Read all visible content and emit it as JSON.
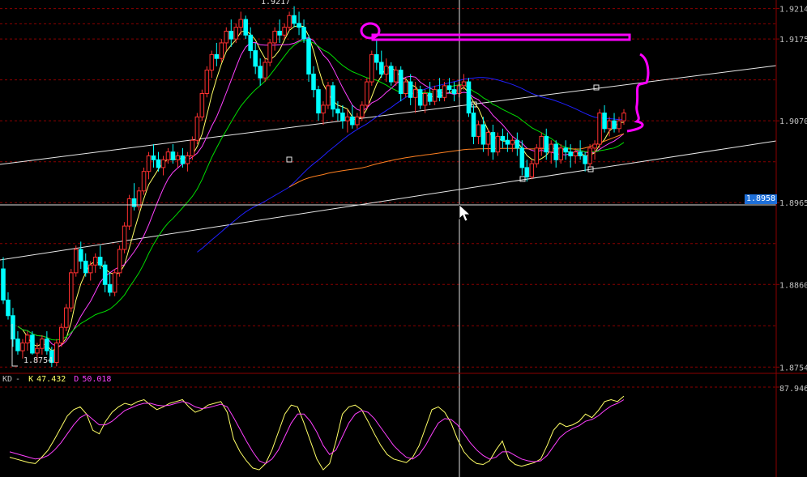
{
  "chart_data": [
    {
      "type": "candlestick",
      "title": "",
      "y_ticks": [
        "1.9175",
        "1.9070",
        "1.8965",
        "1.8860",
        "1.8754"
      ],
      "top_tick": "1.9214",
      "ylim": [
        1.8746,
        1.9225
      ],
      "current_price": "1.8958",
      "high_label": "1.9217",
      "low_label": "1.8754",
      "colors": {
        "up": "#ff3030",
        "down": "#00ffff",
        "ma5": "#ffff66",
        "ma10": "#ff40ff",
        "ma20": "#00dd00",
        "ma60": "#2020ff",
        "ma120": "#ff8020",
        "grid": "#8b0000"
      },
      "ohlc": [
        [
          1.888,
          1.8895,
          1.8835,
          1.884
        ],
        [
          1.884,
          1.885,
          1.8815,
          1.882
        ],
        [
          1.882,
          1.883,
          1.878,
          1.879
        ],
        [
          1.879,
          1.88,
          1.877,
          1.8775
        ],
        [
          1.8775,
          1.879,
          1.8765,
          1.8785
        ],
        [
          1.8785,
          1.88,
          1.8775,
          1.8795
        ],
        [
          1.8795,
          1.88,
          1.877,
          1.8772
        ],
        [
          1.8772,
          1.8785,
          1.876,
          1.8778
        ],
        [
          1.8778,
          1.8795,
          1.877,
          1.879
        ],
        [
          1.879,
          1.88,
          1.877,
          1.8775
        ],
        [
          1.8775,
          1.878,
          1.8754,
          1.876
        ],
        [
          1.876,
          1.879,
          1.8755,
          1.8785
        ],
        [
          1.8785,
          1.881,
          1.878,
          1.8805
        ],
        [
          1.8805,
          1.8835,
          1.88,
          1.883
        ],
        [
          1.883,
          1.888,
          1.8825,
          1.8875
        ],
        [
          1.8875,
          1.891,
          1.887,
          1.8905
        ],
        [
          1.8905,
          1.8915,
          1.888,
          1.889
        ],
        [
          1.889,
          1.89,
          1.887,
          1.8875
        ],
        [
          1.8875,
          1.889,
          1.8865,
          1.8885
        ],
        [
          1.8885,
          1.89,
          1.8875,
          1.8895
        ],
        [
          1.8895,
          1.891,
          1.888,
          1.8885
        ],
        [
          1.8885,
          1.889,
          1.885,
          1.886
        ],
        [
          1.886,
          1.8875,
          1.8845,
          1.885
        ],
        [
          1.885,
          1.888,
          1.8845,
          1.8875
        ],
        [
          1.8875,
          1.891,
          1.887,
          1.8905
        ],
        [
          1.8905,
          1.894,
          1.89,
          1.8935
        ],
        [
          1.8935,
          1.8975,
          1.893,
          1.897
        ],
        [
          1.897,
          1.899,
          1.8955,
          1.896
        ],
        [
          1.896,
          1.8985,
          1.8955,
          1.898
        ],
        [
          1.898,
          1.901,
          1.8975,
          1.9005
        ],
        [
          1.9005,
          1.903,
          1.8995,
          1.9025
        ],
        [
          1.9025,
          1.904,
          1.901,
          1.902
        ],
        [
          1.902,
          1.903,
          1.9005,
          1.901
        ],
        [
          1.901,
          1.9025,
          1.9,
          1.902
        ],
        [
          1.902,
          1.9035,
          1.9015,
          1.903
        ],
        [
          1.903,
          1.904,
          1.9015,
          1.902
        ],
        [
          1.902,
          1.903,
          1.901,
          1.9025
        ],
        [
          1.9025,
          1.9035,
          1.901,
          1.9015
        ],
        [
          1.9015,
          1.903,
          1.9005,
          1.9025
        ],
        [
          1.9025,
          1.905,
          1.902,
          1.9045
        ],
        [
          1.9045,
          1.908,
          1.904,
          1.9075
        ],
        [
          1.9075,
          1.911,
          1.907,
          1.9105
        ],
        [
          1.9105,
          1.914,
          1.91,
          1.9135
        ],
        [
          1.9135,
          1.916,
          1.9125,
          1.9155
        ],
        [
          1.9155,
          1.917,
          1.914,
          1.915
        ],
        [
          1.915,
          1.9175,
          1.9145,
          1.917
        ],
        [
          1.917,
          1.919,
          1.916,
          1.9185
        ],
        [
          1.9185,
          1.92,
          1.9165,
          1.9175
        ],
        [
          1.9175,
          1.9195,
          1.917,
          1.919
        ],
        [
          1.919,
          1.921,
          1.918,
          1.92
        ],
        [
          1.92,
          1.9205,
          1.9175,
          1.918
        ],
        [
          1.918,
          1.919,
          1.915,
          1.916
        ],
        [
          1.916,
          1.917,
          1.913,
          1.914
        ],
        [
          1.914,
          1.915,
          1.9115,
          1.9125
        ],
        [
          1.9125,
          1.915,
          1.912,
          1.9145
        ],
        [
          1.9145,
          1.9175,
          1.914,
          1.917
        ],
        [
          1.917,
          1.919,
          1.916,
          1.9185
        ],
        [
          1.9185,
          1.92,
          1.917,
          1.918
        ],
        [
          1.918,
          1.9195,
          1.9175,
          1.919
        ],
        [
          1.919,
          1.921,
          1.9185,
          1.9205
        ],
        [
          1.9205,
          1.9217,
          1.919,
          1.9195
        ],
        [
          1.9195,
          1.921,
          1.918,
          1.919
        ],
        [
          1.919,
          1.92,
          1.917,
          1.9175
        ],
        [
          1.9175,
          1.918,
          1.912,
          1.913
        ],
        [
          1.913,
          1.914,
          1.91,
          1.911
        ],
        [
          1.911,
          1.9115,
          1.907,
          1.908
        ],
        [
          1.908,
          1.9095,
          1.9065,
          1.909
        ],
        [
          1.909,
          1.912,
          1.9085,
          1.9115
        ],
        [
          1.9115,
          1.912,
          1.9075,
          1.9085
        ],
        [
          1.9085,
          1.9095,
          1.907,
          1.908
        ],
        [
          1.908,
          1.909,
          1.906,
          1.907
        ],
        [
          1.907,
          1.9085,
          1.9055,
          1.9075
        ],
        [
          1.9075,
          1.909,
          1.906,
          1.9065
        ],
        [
          1.9065,
          1.908,
          1.906,
          1.9075
        ],
        [
          1.9075,
          1.9095,
          1.907,
          1.909
        ],
        [
          1.909,
          1.9125,
          1.9085,
          1.912
        ],
        [
          1.912,
          1.916,
          1.9115,
          1.9155
        ],
        [
          1.9155,
          1.9175,
          1.9135,
          1.9145
        ],
        [
          1.9145,
          1.916,
          1.9125,
          1.913
        ],
        [
          1.913,
          1.915,
          1.912,
          1.914
        ],
        [
          1.914,
          1.9145,
          1.9115,
          1.912
        ],
        [
          1.912,
          1.914,
          1.9115,
          1.9135
        ],
        [
          1.9135,
          1.914,
          1.9095,
          1.9105
        ],
        [
          1.9105,
          1.9125,
          1.91,
          1.912
        ],
        [
          1.912,
          1.913,
          1.909,
          1.91
        ],
        [
          1.91,
          1.912,
          1.908,
          1.911
        ],
        [
          1.911,
          1.9115,
          1.9085,
          1.909
        ],
        [
          1.909,
          1.911,
          1.908,
          1.9105
        ],
        [
          1.9105,
          1.912,
          1.909,
          1.9095
        ],
        [
          1.9095,
          1.9115,
          1.909,
          1.911
        ],
        [
          1.911,
          1.9125,
          1.9095,
          1.91
        ],
        [
          1.91,
          1.912,
          1.9095,
          1.9115
        ],
        [
          1.9115,
          1.9125,
          1.9105,
          1.911
        ],
        [
          1.911,
          1.912,
          1.9095,
          1.9105
        ],
        [
          1.9105,
          1.912,
          1.91,
          1.9115
        ],
        [
          1.9115,
          1.913,
          1.911,
          1.912
        ],
        [
          1.912,
          1.9125,
          1.9075,
          1.908
        ],
        [
          1.908,
          1.909,
          1.904,
          1.905
        ],
        [
          1.905,
          1.907,
          1.904,
          1.9065
        ],
        [
          1.9065,
          1.9075,
          1.903,
          1.904
        ],
        [
          1.904,
          1.906,
          1.9025,
          1.9055
        ],
        [
          1.9055,
          1.9065,
          1.902,
          1.903
        ],
        [
          1.903,
          1.9055,
          1.9025,
          1.905
        ],
        [
          1.905,
          1.906,
          1.9035,
          1.9045
        ],
        [
          1.9045,
          1.9055,
          1.903,
          1.904
        ],
        [
          1.904,
          1.905,
          1.903,
          1.9045
        ],
        [
          1.9045,
          1.9055,
          1.9025,
          1.9035
        ],
        [
          1.9035,
          1.9045,
          1.9,
          1.901
        ],
        [
          1.901,
          1.902,
          1.8992,
          1.8998
        ],
        [
          1.8998,
          1.902,
          1.8995,
          1.9015
        ],
        [
          1.9015,
          1.904,
          1.901,
          1.9035
        ],
        [
          1.9035,
          1.9055,
          1.9025,
          1.905
        ],
        [
          1.905,
          1.906,
          1.902,
          1.903
        ],
        [
          1.903,
          1.9045,
          1.9015,
          1.904
        ],
        [
          1.904,
          1.9045,
          1.901,
          1.902
        ],
        [
          1.902,
          1.904,
          1.9015,
          1.9035
        ],
        [
          1.9035,
          1.9045,
          1.902,
          1.903
        ],
        [
          1.903,
          1.904,
          1.901,
          1.9025
        ],
        [
          1.9025,
          1.9035,
          1.9015,
          1.903
        ],
        [
          1.903,
          1.9045,
          1.902,
          1.9025
        ],
        [
          1.9025,
          1.903,
          1.9005,
          1.9015
        ],
        [
          1.9015,
          1.904,
          1.901,
          1.9035
        ],
        [
          1.9035,
          1.9045,
          1.902,
          1.904
        ],
        [
          1.904,
          1.9085,
          1.9035,
          1.908
        ],
        [
          1.908,
          1.909,
          1.9055,
          1.906
        ],
        [
          1.906,
          1.9075,
          1.905,
          1.907
        ],
        [
          1.907,
          1.908,
          1.9055,
          1.906
        ],
        [
          1.906,
          1.9075,
          1.9055,
          1.907
        ],
        [
          1.907,
          1.9085,
          1.9065,
          1.908
        ]
      ]
    },
    {
      "type": "line",
      "title": "KD",
      "legend": [
        {
          "name": "KD",
          "value": "-",
          "color": "#c0c0c0"
        },
        {
          "name": "K",
          "value": "47.432",
          "color": "#ffff66"
        },
        {
          "name": "D",
          "value": "50.018",
          "color": "#ff40ff"
        }
      ],
      "y_tick": "87.946",
      "series": [
        {
          "name": "K",
          "color": "#ffff66",
          "values": [
            22,
            20,
            18,
            16,
            15,
            22,
            30,
            42,
            55,
            68,
            75,
            78,
            70,
            52,
            48,
            62,
            72,
            78,
            82,
            80,
            84,
            86,
            80,
            75,
            78,
            82,
            84,
            86,
            78,
            72,
            75,
            80,
            82,
            84,
            72,
            42,
            28,
            18,
            10,
            8,
            15,
            30,
            50,
            70,
            80,
            78,
            60,
            40,
            20,
            8,
            15,
            40,
            70,
            78,
            80,
            75,
            62,
            48,
            35,
            25,
            20,
            18,
            16,
            22,
            35,
            55,
            75,
            78,
            72,
            60,
            42,
            28,
            20,
            15,
            14,
            18,
            30,
            40,
            20,
            14,
            12,
            14,
            16,
            20,
            35,
            52,
            60,
            56,
            58,
            62,
            70,
            66,
            74,
            84,
            86,
            84,
            90
          ]
        },
        {
          "name": "D",
          "color": "#ff40ff",
          "values": [
            28,
            26,
            24,
            22,
            20,
            21,
            24,
            30,
            38,
            48,
            58,
            66,
            70,
            64,
            58,
            58,
            62,
            68,
            74,
            77,
            80,
            82,
            82,
            80,
            79,
            80,
            82,
            84,
            82,
            78,
            76,
            77,
            79,
            81,
            78,
            66,
            53,
            40,
            28,
            18,
            15,
            20,
            30,
            45,
            60,
            70,
            70,
            62,
            50,
            35,
            25,
            30,
            45,
            60,
            70,
            74,
            72,
            65,
            55,
            45,
            35,
            28,
            22,
            20,
            25,
            35,
            48,
            60,
            65,
            64,
            58,
            48,
            38,
            30,
            24,
            20,
            22,
            28,
            28,
            24,
            20,
            18,
            17,
            18,
            24,
            34,
            44,
            50,
            54,
            57,
            62,
            64,
            68,
            74,
            79,
            82,
            86
          ]
        }
      ]
    }
  ]
}
